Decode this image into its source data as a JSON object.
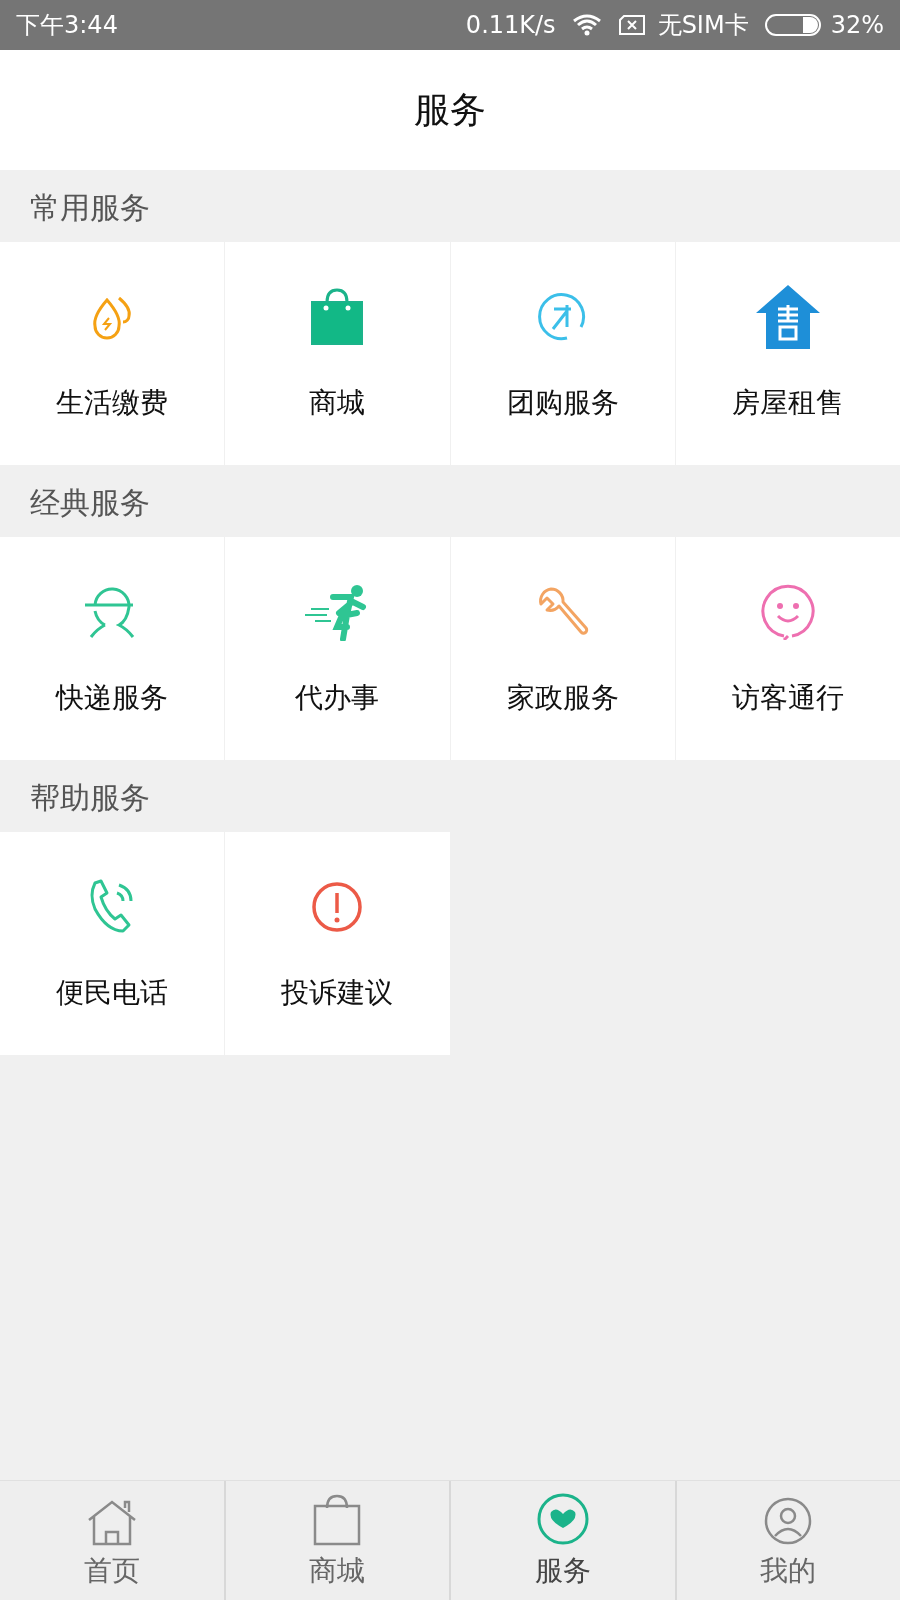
{
  "status_bar": {
    "time": "下午3:44",
    "speed": "0.11K/s",
    "sim": "无SIM卡",
    "battery": "32%"
  },
  "title": "服务",
  "sections": [
    {
      "title": "常用服务",
      "items": [
        "生活缴费",
        "商城",
        "团购服务",
        "房屋租售"
      ]
    },
    {
      "title": "经典服务",
      "items": [
        "快递服务",
        "代办事",
        "家政服务",
        "访客通行"
      ]
    },
    {
      "title": "帮助服务",
      "items": [
        "便民电话",
        "投诉建议"
      ]
    }
  ],
  "tabs": [
    {
      "label": "首页",
      "selected": false
    },
    {
      "label": "商城",
      "selected": false
    },
    {
      "label": "服务",
      "selected": true
    },
    {
      "label": "我的",
      "selected": false
    }
  ]
}
